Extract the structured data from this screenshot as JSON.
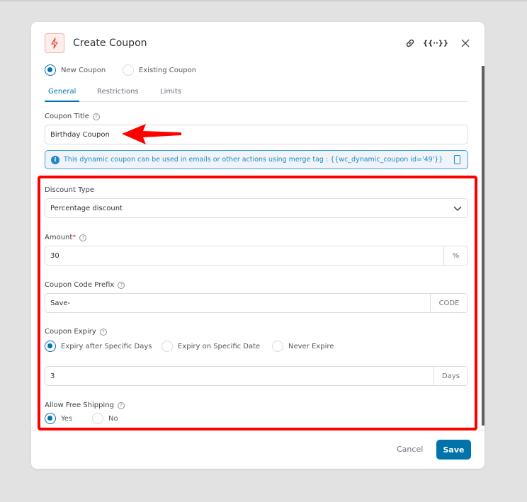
{
  "modal": {
    "title": "Create Coupon",
    "icons": [
      "bolt-icon",
      "link-icon",
      "merge-tag-icon",
      "close-icon"
    ],
    "coupon_mode": {
      "options": [
        "New Coupon",
        "Existing Coupon"
      ],
      "selected": "New Coupon"
    },
    "tabs": [
      "General",
      "Restrictions",
      "Limits"
    ],
    "active_tab": "General"
  },
  "form": {
    "coupon_title_label": "Coupon Title",
    "coupon_title_value": "Birthday Coupon",
    "info_text": "This dynamic coupon can be used in emails or other actions using merge tag : {{wc_dynamic_coupon id='49'}}",
    "discount_type_label": "Discount Type",
    "discount_type_value": "Percentage discount",
    "amount_label": "Amount",
    "amount_required": "*",
    "amount_value": "30",
    "amount_suffix": "%",
    "prefix_label": "Coupon Code Prefix",
    "prefix_value": "Save-",
    "prefix_suffix": "CODE",
    "expiry_label": "Coupon Expiry",
    "expiry_options": [
      "Expiry after Specific Days",
      "Expiry on Specific Date",
      "Never Expire"
    ],
    "expiry_selected": "Expiry after Specific Days",
    "expiry_value": "3",
    "expiry_suffix": "Days",
    "shipping_label": "Allow Free Shipping",
    "shipping_options": [
      "Yes",
      "No"
    ],
    "shipping_selected": "Yes"
  },
  "footer": {
    "cancel": "Cancel",
    "save": "Save"
  },
  "colors": {
    "accent": "#0073aa",
    "highlight": "#ff0000",
    "info": "#1f8bc9"
  }
}
